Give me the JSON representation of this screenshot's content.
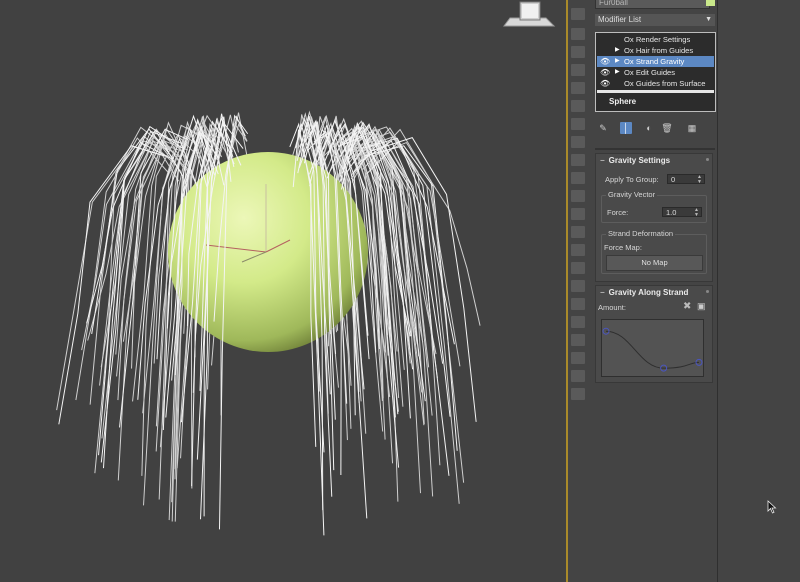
{
  "object_name": "Fur0ball",
  "object_color": "#c9e88a",
  "modifier_list": {
    "label": "Modifier List"
  },
  "stack": {
    "items": [
      {
        "label": "Ox Render Settings",
        "eye": "",
        "expand": ""
      },
      {
        "label": "Ox Hair from Guides",
        "eye": "",
        "expand": "▶"
      },
      {
        "label": "Ox Strand Gravity",
        "eye": "👁",
        "expand": "▶",
        "selected": true
      },
      {
        "label": "Ox Edit Guides",
        "eye": "👁",
        "expand": "▶"
      },
      {
        "label": "Ox Guides from Surface",
        "eye": "👁",
        "expand": ""
      }
    ],
    "base_object": "Sphere"
  },
  "stack_icons": [
    "pin-icon",
    "show-end-result-icon",
    "make-unique-icon",
    "remove-modifier-icon",
    "configure-sets-icon"
  ],
  "gravity_settings": {
    "title": "Gravity Settings",
    "apply_to_group_label": "Apply To Group:",
    "apply_to_group_value": "0",
    "gravity_vector_title": "Gravity Vector",
    "force_label": "Force:",
    "force_value": "1.0",
    "strand_deformation_title": "Strand Deformation",
    "force_map_label": "Force Map:",
    "no_map_label": "No Map"
  },
  "gravity_along_strand": {
    "title": "Gravity Along Strand",
    "amount_label": "Amount:",
    "curve_points": [
      [
        0.0,
        0.85
      ],
      [
        0.62,
        0.08
      ],
      [
        1.0,
        0.2
      ]
    ]
  },
  "colors": {
    "accent": "#5c88c3",
    "sphere": "#cfe886",
    "viewport_bg": "#414141",
    "viewport_border": "#a98a2a"
  }
}
